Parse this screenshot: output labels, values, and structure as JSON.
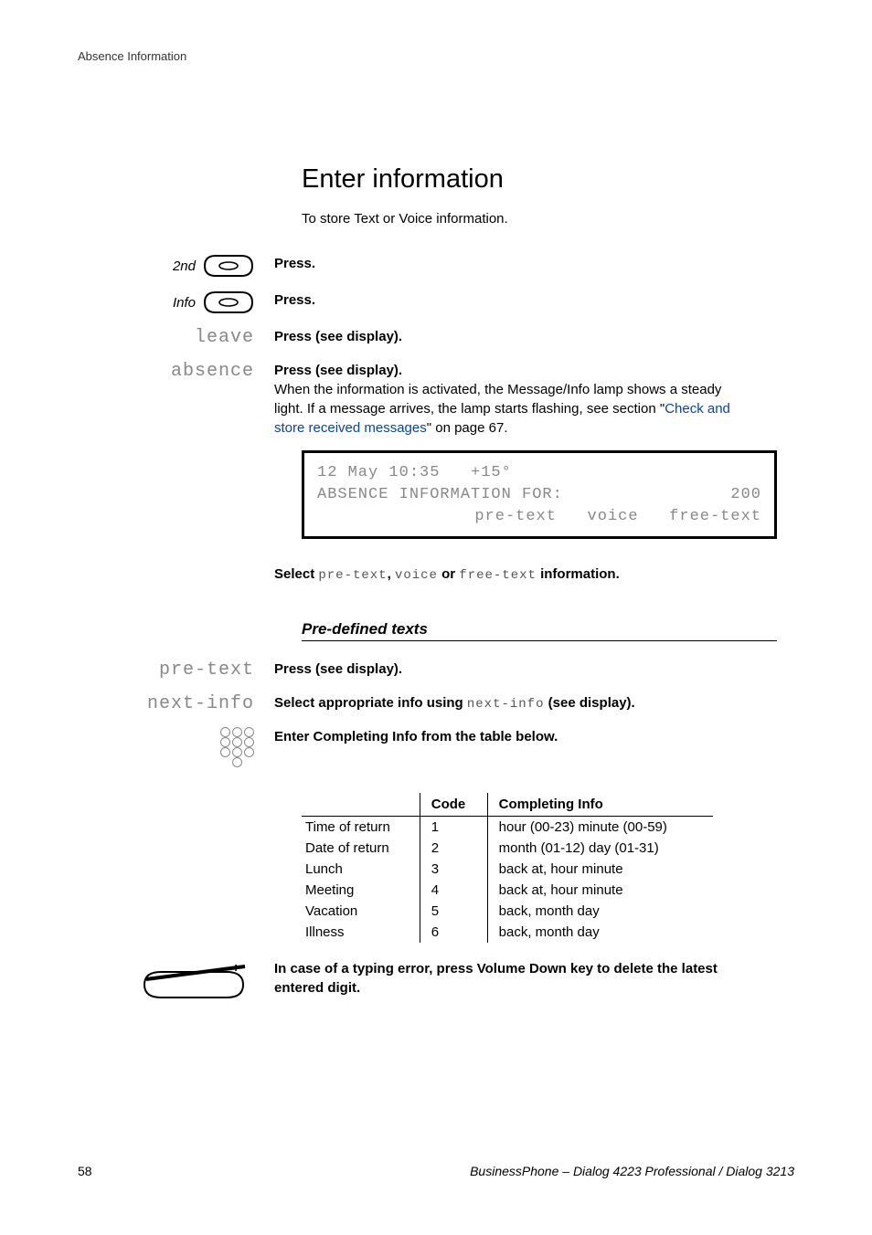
{
  "header": {
    "section": "Absence Information"
  },
  "title": "Enter information",
  "intro": "To store Text or Voice information.",
  "steps": {
    "s1": {
      "label": "2nd",
      "action": "Press."
    },
    "s2": {
      "label": "Info",
      "action": "Press."
    },
    "s3": {
      "label": "leave",
      "action": "Press (see display)."
    },
    "s4": {
      "label": "absence",
      "action": "Press (see display).",
      "text_a": "When the information is activated, the Message/Info lamp shows a steady light. If a message arrives, the lamp starts flashing, see section \"",
      "link": "Check and store received messages",
      "text_b": "\" on page 67."
    }
  },
  "display": {
    "l1a": "12 May 10:35   +15°",
    "l2a": "ABSENCE INFORMATION FOR:",
    "l2b": "200",
    "l3a": "pre-text   voice   free-text"
  },
  "after_display": {
    "a": "Select ",
    "m1": "pre-text",
    "c": ", ",
    "m2": "voice",
    "or": " or ",
    "m3": "free-text",
    "b": " information."
  },
  "subhead": "Pre-defined texts",
  "pre_steps": {
    "p1": {
      "label": "pre-text",
      "action": "Press (see display)."
    },
    "p2": {
      "label": "next-info",
      "a": "Select appropriate info using ",
      "m": "next-info",
      "b": " (see display)."
    },
    "p3": {
      "action": "Enter Completing Info from the table below."
    }
  },
  "table": {
    "h1": "",
    "h2": "Code",
    "h3": "Completing Info",
    "rows": [
      {
        "c1": "Time of return",
        "c2": "1",
        "c3": "hour (00-23) minute (00-59)"
      },
      {
        "c1": "Date of return",
        "c2": "2",
        "c3": "month (01-12) day (01-31)"
      },
      {
        "c1": "Lunch",
        "c2": "3",
        "c3": "back at, hour minute"
      },
      {
        "c1": "Meeting",
        "c2": "4",
        "c3": "back at, hour minute"
      },
      {
        "c1": "Vacation",
        "c2": "5",
        "c3": "back, month day"
      },
      {
        "c1": "Illness",
        "c2": "6",
        "c3": "back, month day"
      }
    ]
  },
  "vol_note": "In case of a typing error, press Volume Down key to delete the latest entered digit.",
  "footer": {
    "page": "58",
    "doc": "BusinessPhone – Dialog 4223 Professional / Dialog 3213"
  }
}
